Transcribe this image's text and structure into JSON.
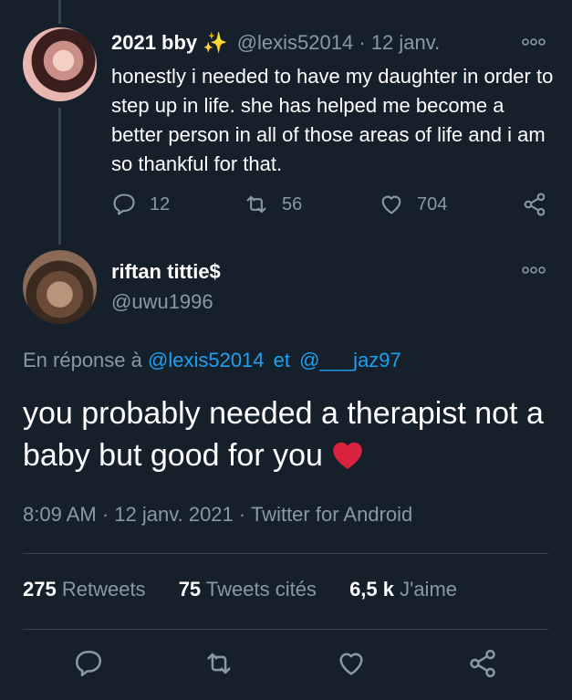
{
  "parent_tweet": {
    "display_name": "2021 bby",
    "emoji": "✨",
    "handle": "@lexis52014",
    "separator": "·",
    "date": "12 janv.",
    "text": "honestly i needed to have my daughter in order to step up in life. she has helped me become a better person in all of those areas of life and i am so thankful for that.",
    "reply_count": "12",
    "retweet_count": "56",
    "like_count": "704"
  },
  "reply_tweet": {
    "display_name": "riftan tittie$",
    "handle": "@uwu1996",
    "in_reply_prefix": "En réponse à",
    "in_reply_user1": "@lexis52014",
    "in_reply_and": "et",
    "in_reply_user2": "@___jaz97",
    "text": "you probably needed a therapist not a baby but good for you",
    "emoji": "❤️",
    "time": "8:09 AM",
    "date": "12 janv. 2021",
    "source": "Twitter for Android",
    "sep": "·"
  },
  "stats": {
    "retweets_num": "275",
    "retweets_label": "Retweets",
    "quotes_num": "75",
    "quotes_label": "Tweets cités",
    "likes_num": "6,5 k",
    "likes_label": "J'aime"
  },
  "icons": {
    "reply": "reply-icon",
    "retweet": "retweet-icon",
    "like": "heart-icon",
    "share": "share-icon",
    "more": "more-icon"
  },
  "colors": {
    "background": "#15202b",
    "secondary_text": "#8899a6",
    "link": "#1da1f2",
    "divider": "#38444d",
    "heart_emoji": "#e0245e"
  }
}
